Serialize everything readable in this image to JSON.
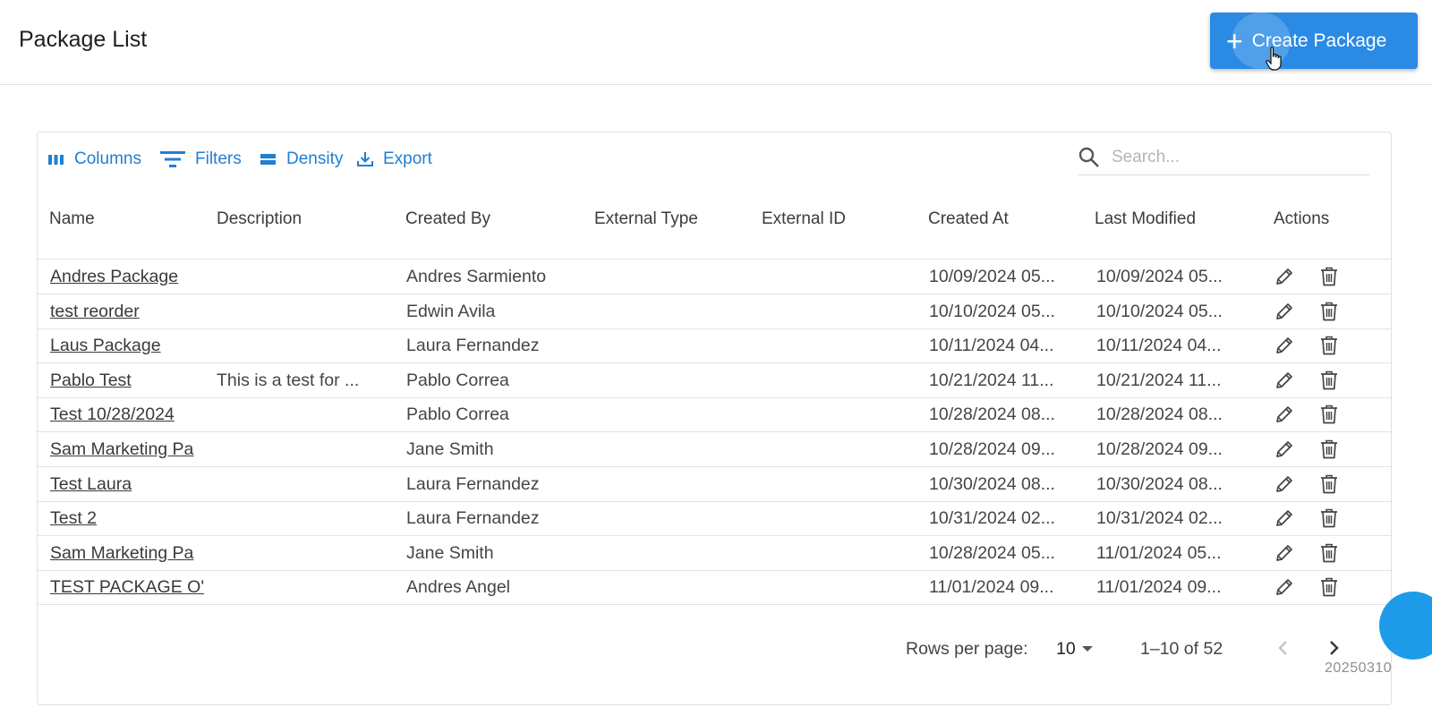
{
  "header": {
    "title": "Package List",
    "create_label": "Create Package"
  },
  "toolbar": {
    "columns_label": "Columns",
    "filters_label": "Filters",
    "density_label": "Density",
    "export_label": "Export",
    "search_placeholder": "Search..."
  },
  "columns": [
    "Name",
    "Description",
    "Created By",
    "External Type",
    "External ID",
    "Created At",
    "Last Modified",
    "Actions"
  ],
  "rows": [
    {
      "name": "Andres Package",
      "description": "",
      "created_by": "Andres Sarmiento",
      "external_type": "",
      "external_id": "",
      "created_at": "10/09/2024 05...",
      "last_modified": "10/09/2024 05..."
    },
    {
      "name": "test reorder",
      "description": "",
      "created_by": "Edwin Avila",
      "external_type": "",
      "external_id": "",
      "created_at": "10/10/2024 05...",
      "last_modified": "10/10/2024 05..."
    },
    {
      "name": "Laus Package",
      "description": "",
      "created_by": "Laura Fernandez",
      "external_type": "",
      "external_id": "",
      "created_at": "10/11/2024 04...",
      "last_modified": "10/11/2024 04..."
    },
    {
      "name": "Pablo Test",
      "description": "This is a test for ...",
      "created_by": "Pablo Correa",
      "external_type": "",
      "external_id": "",
      "created_at": "10/21/2024 11...",
      "last_modified": "10/21/2024 11..."
    },
    {
      "name": "Test 10/28/2024",
      "description": "",
      "created_by": "Pablo Correa",
      "external_type": "",
      "external_id": "",
      "created_at": "10/28/2024 08...",
      "last_modified": "10/28/2024 08..."
    },
    {
      "name": "Sam Marketing Pa",
      "description": "",
      "created_by": "Jane Smith",
      "external_type": "",
      "external_id": "",
      "created_at": "10/28/2024 09...",
      "last_modified": "10/28/2024 09..."
    },
    {
      "name": "Test Laura",
      "description": "",
      "created_by": "Laura Fernandez",
      "external_type": "",
      "external_id": "",
      "created_at": "10/30/2024 08...",
      "last_modified": "10/30/2024 08..."
    },
    {
      "name": "Test 2",
      "description": "",
      "created_by": "Laura Fernandez",
      "external_type": "",
      "external_id": "",
      "created_at": "10/31/2024 02...",
      "last_modified": "10/31/2024 02..."
    },
    {
      "name": "Sam Marketing Pa",
      "description": "",
      "created_by": "Jane Smith",
      "external_type": "",
      "external_id": "",
      "created_at": "10/28/2024 05...",
      "last_modified": "11/01/2024 05..."
    },
    {
      "name": "TEST PACKAGE O'",
      "description": "",
      "created_by": "Andres Angel",
      "external_type": "",
      "external_id": "",
      "created_at": "11/01/2024 09...",
      "last_modified": "11/01/2024 09..."
    }
  ],
  "footer": {
    "rows_per_page_label": "Rows per page:",
    "rows_per_page_value": "10",
    "range_label": "1–10 of 52"
  },
  "watermark": "20250310",
  "icons": {
    "create": "plus-icon",
    "columns": "columns-icon",
    "filters": "filter-icon",
    "density": "density-icon",
    "export": "download-icon",
    "search": "search-icon",
    "edit": "pencil-icon",
    "delete": "trash-icon",
    "prev": "chevron-left-icon",
    "next": "chevron-right-icon",
    "dropdown": "caret-down-icon"
  },
  "colors": {
    "accent": "#2a8ae4",
    "link": "#1f7fd3",
    "fab": "#1e9be8"
  }
}
